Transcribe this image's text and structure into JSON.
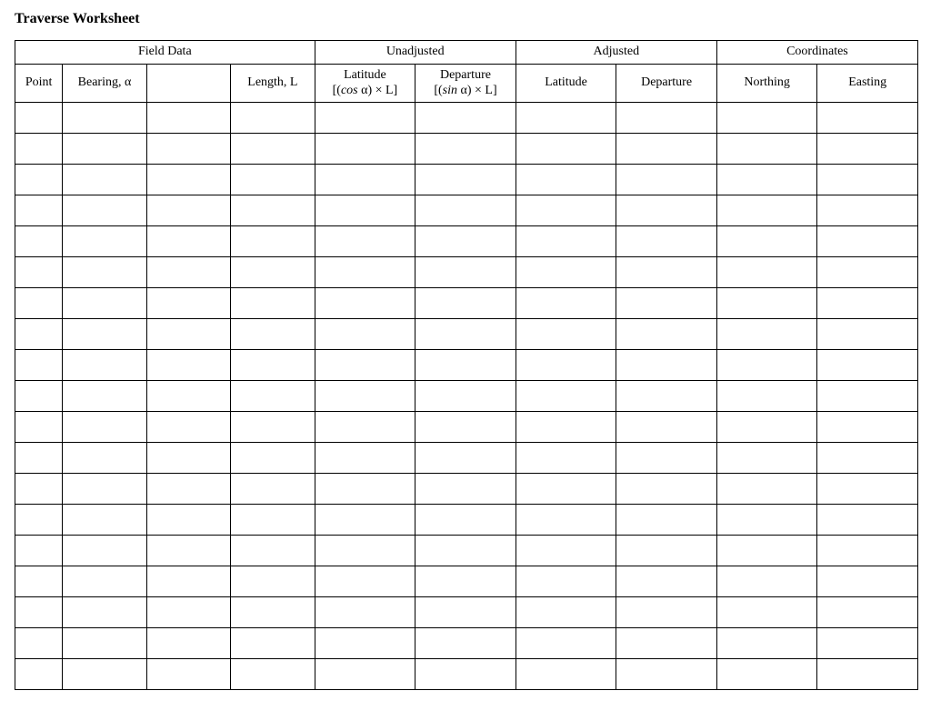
{
  "title": "Traverse Worksheet",
  "groups": {
    "field_data": "Field Data",
    "unadjusted": "Unadjusted",
    "adjusted": "Adjusted",
    "coordinates": "Coordinates"
  },
  "columns": {
    "point": "Point",
    "bearing": "Bearing, α",
    "blank": "",
    "length": "Length, L",
    "unadj_latitude_label": "Latitude",
    "unadj_latitude_formula_pre": "[(",
    "unadj_latitude_formula_fn": "cos",
    "unadj_latitude_formula_post": " α) × L]",
    "unadj_departure_label": "Departure",
    "unadj_departure_formula_pre": "[(",
    "unadj_departure_formula_fn": "sin",
    "unadj_departure_formula_post": " α) × L]",
    "adj_latitude": "Latitude",
    "adj_departure": "Departure",
    "northing": "Northing",
    "easting": "Easting"
  },
  "row_count": 19
}
